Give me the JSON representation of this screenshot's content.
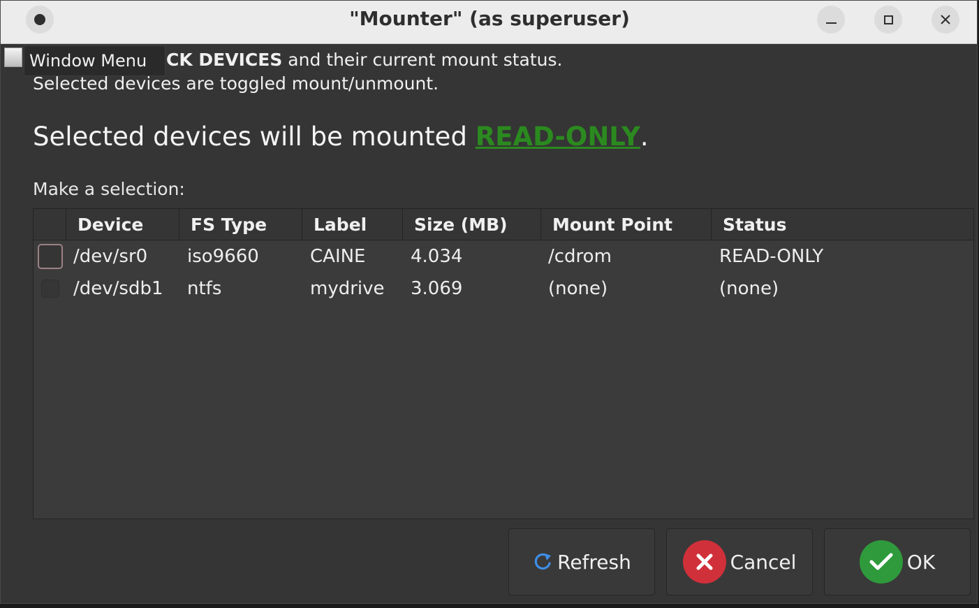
{
  "window": {
    "title": "\"Mounter\" (as superuser)"
  },
  "tooltip": {
    "window_menu": "Window Menu"
  },
  "intro": {
    "line1_bold": "CK DEVICES",
    "line1_rest": " and their current mount status.",
    "line2": "Selected devices are toggled mount/unmount."
  },
  "headline": {
    "prefix": "Selected devices will be mounted ",
    "mode": "READ-ONLY",
    "suffix": "."
  },
  "selection": {
    "label": "Make a selection:"
  },
  "table": {
    "headers": [
      "Device",
      "FS Type",
      "Label",
      "Size (MB)",
      "Mount Point",
      "Status"
    ],
    "rows": [
      {
        "checked": false,
        "device": "/dev/sr0",
        "fs_type": "iso9660",
        "label": "CAINE",
        "size": "4.034",
        "mount_point": "/cdrom",
        "status": "READ-ONLY"
      },
      {
        "checked": false,
        "device": "/dev/sdb1",
        "fs_type": "ntfs",
        "label": "mydrive",
        "size": "3.069",
        "mount_point": "(none)",
        "status": "(none)"
      }
    ]
  },
  "buttons": {
    "refresh": "Refresh",
    "cancel": "Cancel",
    "ok": "OK"
  },
  "colors": {
    "read_only_accent": "#2b8a1f",
    "cancel_icon": "#d0303a",
    "ok_icon": "#2f9a3c",
    "refresh_icon": "#3f8ee6"
  },
  "icons": {
    "window_menu": "circle-dot-icon",
    "minimize": "minimize-icon",
    "maximize": "maximize-icon",
    "close": "close-icon",
    "refresh": "refresh-icon",
    "cancel": "cancel-x-icon",
    "ok": "checkmark-icon"
  }
}
